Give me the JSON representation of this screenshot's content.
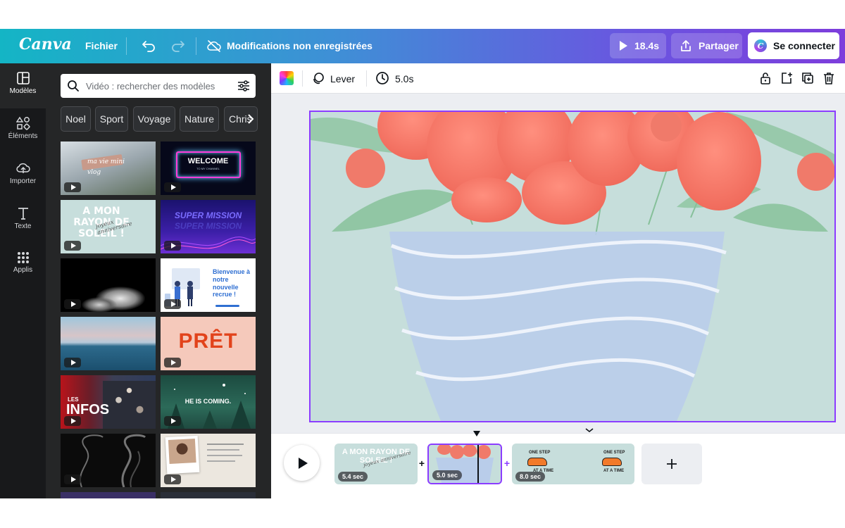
{
  "app": {
    "brand": "Canva",
    "menu_file": "Fichier",
    "save_status": "Modifications non enregistrées"
  },
  "topbar": {
    "play_duration": "18.4s",
    "share_label": "Partager",
    "connect_label": "Se connecter"
  },
  "rail": {
    "items": [
      {
        "label": "Modèles",
        "icon": "templates-icon"
      },
      {
        "label": "Éléments",
        "icon": "elements-icon"
      },
      {
        "label": "Importer",
        "icon": "upload-icon"
      },
      {
        "label": "Texte",
        "icon": "text-icon"
      },
      {
        "label": "Applis",
        "icon": "apps-icon"
      }
    ]
  },
  "panel": {
    "search_placeholder": "Vidéo : rechercher des modèles",
    "chips": [
      "Noel",
      "Sport",
      "Voyage",
      "Nature",
      "Chris"
    ],
    "thumbnails": [
      {
        "text": "ma vie mini vlog"
      },
      {
        "text": "WELCOME",
        "subtext": "TO MY CHANNEL"
      },
      {
        "text": "A MON RAYON DE SOLEIL !",
        "script": "joyeux anniversaire"
      },
      {
        "text": "SUPER MISSION"
      },
      {
        "text": ""
      },
      {
        "text": "Bienvenue à notre nouvelle recrue !"
      },
      {
        "text": ""
      },
      {
        "text": "PRÊT"
      },
      {
        "text": "INFOS",
        "tag": "LES"
      },
      {
        "text": "HE IS COMING."
      },
      {
        "text": ""
      },
      {
        "text": ""
      }
    ]
  },
  "toolbar": {
    "raise_label": "Lever",
    "duration_label": "5.0s"
  },
  "timeline": {
    "clips": [
      {
        "duration": "5.4 sec",
        "text": "A MON RAYON DE SOLEIL !",
        "script": "joyeux anniversaire"
      },
      {
        "duration": "5.0 sec"
      },
      {
        "duration": "8.0 sec",
        "text_a": "ONE STEP",
        "text_b": "AT A TIME"
      }
    ]
  }
}
